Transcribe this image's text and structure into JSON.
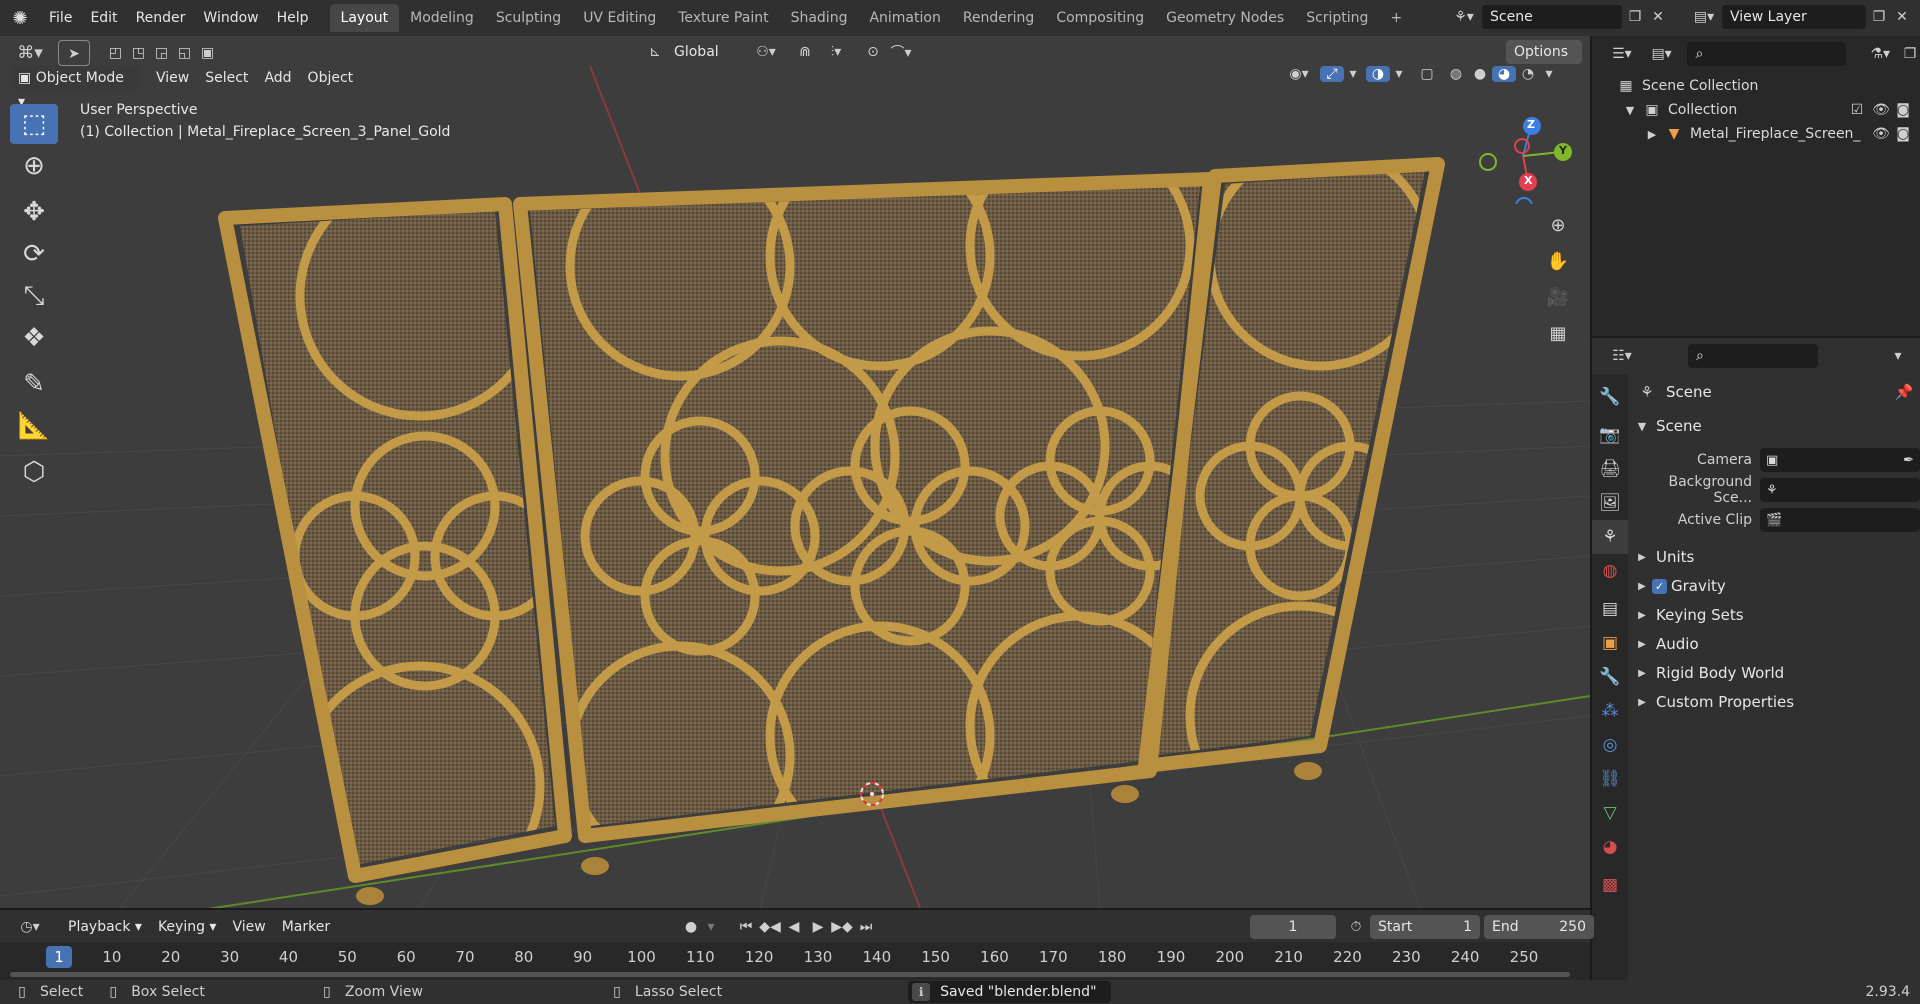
{
  "topbar": {
    "menus": [
      "File",
      "Edit",
      "Render",
      "Window",
      "Help"
    ],
    "workspaces": [
      "Layout",
      "Modeling",
      "Sculpting",
      "UV Editing",
      "Texture Paint",
      "Shading",
      "Animation",
      "Rendering",
      "Compositing",
      "Geometry Nodes",
      "Scripting"
    ],
    "active_workspace": "Layout",
    "add_tab": "+",
    "scene": "Scene",
    "view_layer": "View Layer"
  },
  "viewport": {
    "header": {
      "transform_orientation": "Global",
      "options_label": "Options",
      "mode": "Object Mode",
      "menus": [
        "View",
        "Select",
        "Add",
        "Object"
      ]
    },
    "overlay_text": {
      "line1": "User Perspective",
      "line2": "(1) Collection | Metal_Fireplace_Screen_3_Panel_Gold"
    },
    "gizmo": {
      "x": "X",
      "y": "Y",
      "z": "Z"
    }
  },
  "outliner": {
    "scene_collection": "Scene Collection",
    "collection": "Collection",
    "object": "Metal_Fireplace_Screen_"
  },
  "properties": {
    "context": "Scene",
    "section": "Scene",
    "fields": [
      {
        "label": "Camera"
      },
      {
        "label": "Background Sce..."
      },
      {
        "label": "Active Clip"
      }
    ],
    "subpanels": [
      "Units",
      "Gravity",
      "Keying Sets",
      "Audio",
      "Rigid Body World",
      "Custom Properties"
    ]
  },
  "timeline": {
    "menus": [
      "Playback",
      "Keying",
      "View",
      "Marker"
    ],
    "current_frame": "1",
    "start_label": "Start",
    "start_value": "1",
    "end_label": "End",
    "end_value": "250",
    "ruler": [
      "1",
      "10",
      "20",
      "30",
      "40",
      "50",
      "60",
      "70",
      "80",
      "90",
      "100",
      "110",
      "120",
      "130",
      "140",
      "150",
      "160",
      "170",
      "180",
      "190",
      "200",
      "210",
      "220",
      "230",
      "240",
      "250"
    ]
  },
  "statusbar": {
    "select": "Select",
    "box_select": "Box Select",
    "zoom_view": "Zoom View",
    "lasso_select": "Lasso Select",
    "message": "Saved \"blender.blend\"",
    "version": "2.93.4"
  },
  "colors": {
    "accent": "#4772b3",
    "gold": "#c29a48",
    "mesh": "#6b5a44"
  }
}
